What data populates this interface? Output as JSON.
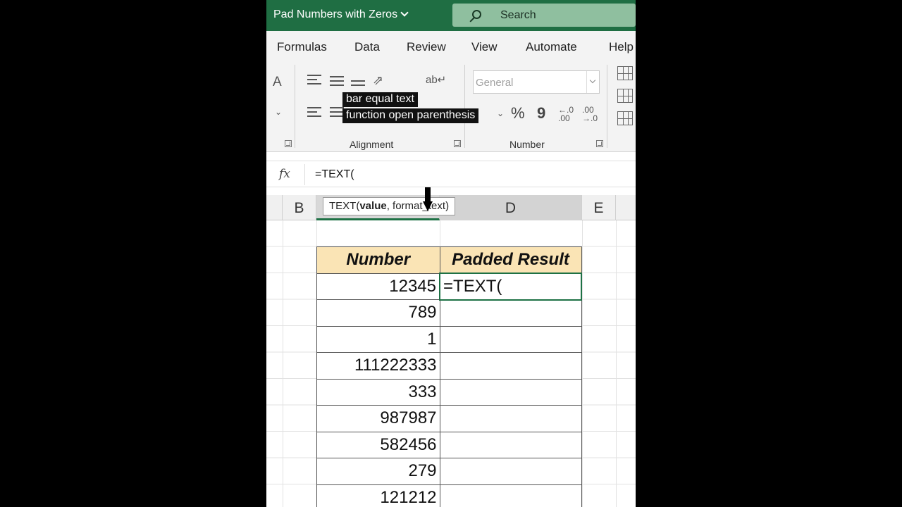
{
  "app": {
    "window_title": "Pad Numbers with Zeros",
    "search_label": "Search"
  },
  "ribbon": {
    "tabs": [
      "Formulas",
      "Data",
      "Review",
      "View",
      "Automate",
      "Help"
    ],
    "groups": {
      "alignment_label": "Alignment",
      "number_label": "Number"
    },
    "number_format": "General",
    "percent_symbol": "%",
    "comma_symbol": "9",
    "increase_decimal": "←.0 .00",
    "decrease_decimal": ".00 →.0",
    "font_size_icon": "A"
  },
  "caption": {
    "line1": "bar equal text",
    "line2": "function open parenthesis"
  },
  "formula_bar": {
    "fx_label": "fx",
    "formula": "=TEXT("
  },
  "columns": {
    "b": "B",
    "d": "D",
    "e": "E"
  },
  "tooltip": {
    "prefix": "TEXT(",
    "bold_arg": "value",
    "rest": ", format_text)"
  },
  "table": {
    "headers": [
      "Number",
      "Padded Result"
    ],
    "rows": [
      {
        "number": "12345",
        "result": "=TEXT("
      },
      {
        "number": "789",
        "result": ""
      },
      {
        "number": "1",
        "result": ""
      },
      {
        "number": "111222333",
        "result": ""
      },
      {
        "number": "333",
        "result": ""
      },
      {
        "number": "987987",
        "result": ""
      },
      {
        "number": "582456",
        "result": ""
      },
      {
        "number": "279",
        "result": ""
      },
      {
        "number": "121212",
        "result": ""
      }
    ]
  },
  "colors": {
    "title_bar": "#1f6e43",
    "header_fill": "#fae4b5",
    "active_cell_border": "#1e7145"
  }
}
